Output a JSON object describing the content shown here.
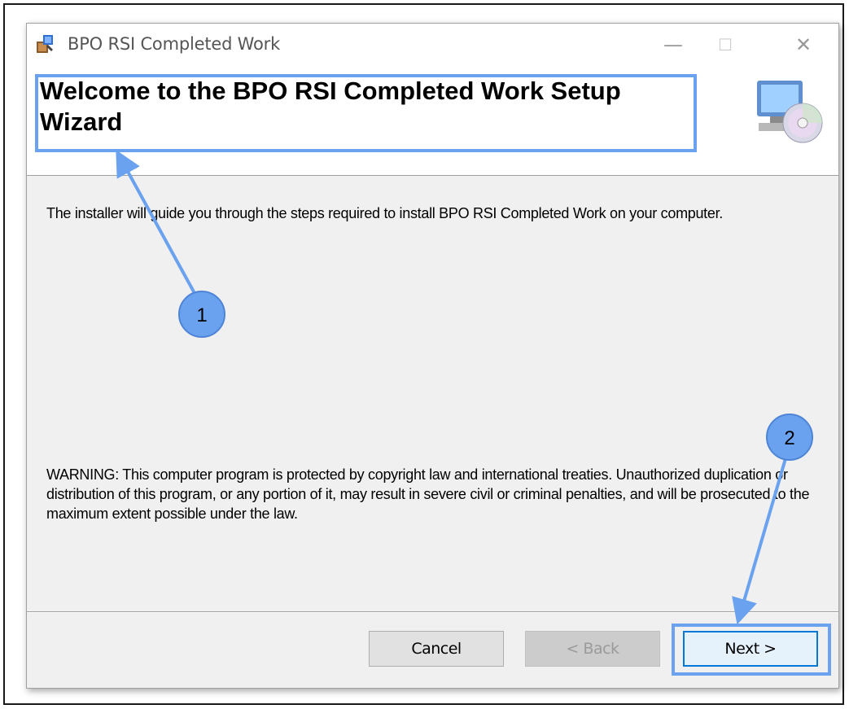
{
  "window": {
    "title": "BPO RSI Completed Work",
    "controls": {
      "minimize": "—",
      "maximize": "☐",
      "close": "✕"
    }
  },
  "header": {
    "title": "Welcome to the BPO RSI Completed Work Setup Wizard",
    "graphic_icon": "computer-cd-icon"
  },
  "body": {
    "intro": "The installer will guide you through the steps required to install BPO RSI Completed Work on your computer.",
    "warning": "WARNING: This computer program is protected by copyright law and international treaties. Unauthorized duplication or distribution of this program, or any portion of it, may result in severe civil or criminal penalties, and will be prosecuted to the maximum extent possible under the law."
  },
  "buttons": {
    "cancel": "Cancel",
    "back": "< Back",
    "next": "Next >"
  },
  "annotations": {
    "marker1": "1",
    "marker2": "2",
    "color": "#6aa2ef"
  }
}
